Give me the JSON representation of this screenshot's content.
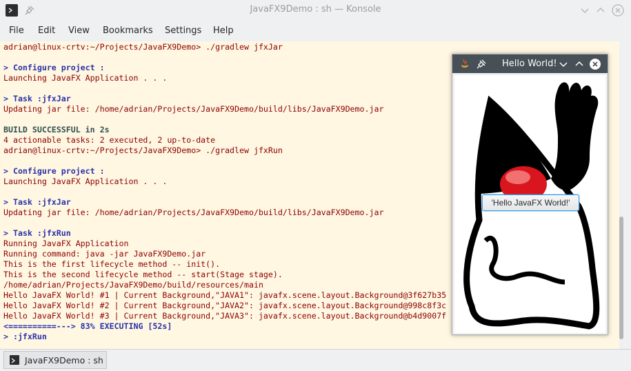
{
  "window": {
    "title": "JavaFX9Demo : sh — Konsole"
  },
  "menu": [
    "File",
    "Edit",
    "View",
    "Bookmarks",
    "Settings",
    "Help"
  ],
  "terminal": {
    "lines": [
      {
        "text": "adrian@linux-crtv:~/Projects/JavaFX9Demo> ./gradlew jfxJar",
        "style": "dark"
      },
      {
        "text": "",
        "style": "dark"
      },
      {
        "text": "> Configure project :",
        "style": "blue"
      },
      {
        "text": "Launching JavaFX Application . . .",
        "style": "dark"
      },
      {
        "text": "",
        "style": "dark"
      },
      {
        "text": "> Task :jfxJar",
        "style": "blue"
      },
      {
        "text": "Updating jar file: /home/adrian/Projects/JavaFX9Demo/build/libs/JavaFX9Demo.jar",
        "style": "dark"
      },
      {
        "text": "",
        "style": "dark"
      },
      {
        "text": "BUILD SUCCESSFUL in 2s",
        "style": "build"
      },
      {
        "text": "4 actionable tasks: 2 executed, 2 up-to-date",
        "style": "dark"
      },
      {
        "text": "adrian@linux-crtv:~/Projects/JavaFX9Demo> ./gradlew jfxRun",
        "style": "dark"
      },
      {
        "text": "",
        "style": "dark"
      },
      {
        "text": "> Configure project :",
        "style": "blue"
      },
      {
        "text": "Launching JavaFX Application . . .",
        "style": "dark"
      },
      {
        "text": "",
        "style": "dark"
      },
      {
        "text": "> Task :jfxJar",
        "style": "blue"
      },
      {
        "text": "Updating jar file: /home/adrian/Projects/JavaFX9Demo/build/libs/JavaFX9Demo.jar",
        "style": "dark"
      },
      {
        "text": "",
        "style": "dark"
      },
      {
        "text": "> Task :jfxRun",
        "style": "blue"
      },
      {
        "text": "Running JavaFX Application",
        "style": "dark"
      },
      {
        "text": "Running command: java -jar JavaFX9Demo.jar",
        "style": "dark"
      },
      {
        "text": "This is the first lifecycle method -- init().",
        "style": "dark"
      },
      {
        "text": "This is the second lifecycle method -- start(Stage stage).",
        "style": "dark"
      },
      {
        "text": "/home/adrian/Projects/JavaFX9Demo/build/resources/main",
        "style": "dark"
      },
      {
        "text": "Hello JavaFX World! #1 | Current Background,\"JAVA1\": javafx.scene.layout.Background@3f627b35",
        "style": "dark"
      },
      {
        "text": "Hello JavaFX World! #2 | Current Background,\"JAVA2\": javafx.scene.layout.Background@998c8f3c",
        "style": "dark"
      },
      {
        "text": "Hello JavaFX World! #3 | Current Background,\"JAVA3\": javafx.scene.layout.Background@b4d9007f",
        "style": "dark"
      },
      {
        "text": "<==========---> 83% EXECUTING [52s]",
        "style": "blue"
      },
      {
        "text": "> :jfxRun",
        "style": "blue"
      }
    ]
  },
  "tab": {
    "label": "JavaFX9Demo : sh"
  },
  "fx_window": {
    "title": "Hello World!",
    "button_label": "'Hello JavaFX World!'"
  },
  "colors": {
    "terminal_bg": "#fff7e2",
    "terminal_text": "#8b0000",
    "terminal_prompt": "#2a31a8",
    "fx_titlebar": "#475057",
    "button_focus": "#3c9ae8"
  },
  "icons": [
    "konsole-icon",
    "pin-icon",
    "chevron-down-icon",
    "chevron-up-icon",
    "close-icon",
    "java-icon"
  ]
}
